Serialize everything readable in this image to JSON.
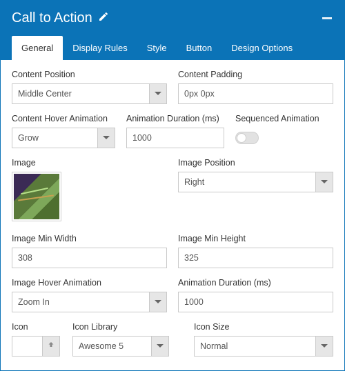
{
  "title": "Call to Action",
  "tabs": [
    "General",
    "Display Rules",
    "Style",
    "Button",
    "Design Options"
  ],
  "activeTab": "General",
  "fields": {
    "contentPosition": {
      "label": "Content Position",
      "value": "Middle Center"
    },
    "contentPadding": {
      "label": "Content Padding",
      "value": "0px 0px"
    },
    "contentHoverAnimation": {
      "label": "Content Hover Animation",
      "value": "Grow"
    },
    "animationDuration1": {
      "label": "Animation Duration (ms)",
      "value": "1000"
    },
    "sequencedAnimation": {
      "label": "Sequenced Animation",
      "on": false
    },
    "image": {
      "label": "Image"
    },
    "imagePosition": {
      "label": "Image Position",
      "value": "Right"
    },
    "imageMinWidth": {
      "label": "Image Min Width",
      "value": "308"
    },
    "imageMinHeight": {
      "label": "Image Min Height",
      "value": "325"
    },
    "imageHoverAnimation": {
      "label": "Image Hover Animation",
      "value": "Zoom In"
    },
    "animationDuration2": {
      "label": "Animation Duration (ms)",
      "value": "1000"
    },
    "icon": {
      "label": "Icon",
      "value": ""
    },
    "iconLibrary": {
      "label": "Icon Library",
      "value": "Awesome 5"
    },
    "iconSize": {
      "label": "Icon Size",
      "value": "Normal"
    }
  }
}
